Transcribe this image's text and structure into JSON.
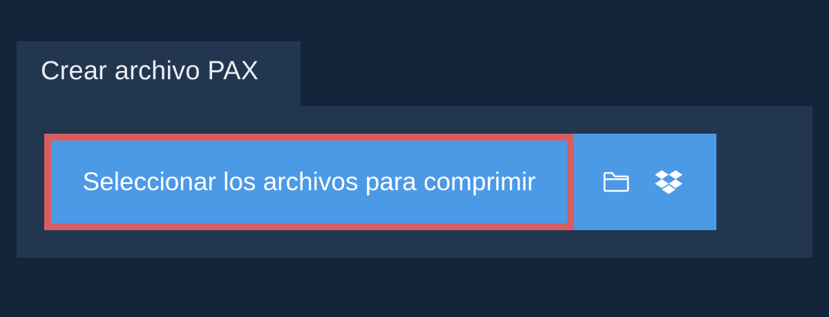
{
  "tab": {
    "title": "Crear archivo PAX"
  },
  "upload": {
    "select_label": "Seleccionar los archivos para comprimir"
  },
  "icons": {
    "folder": "folder-icon",
    "dropbox": "dropbox-icon"
  },
  "colors": {
    "background": "#12253b",
    "panel": "#22364f",
    "button": "#4c9ae6",
    "highlight_border": "#d65d60",
    "text": "#ffffff"
  }
}
